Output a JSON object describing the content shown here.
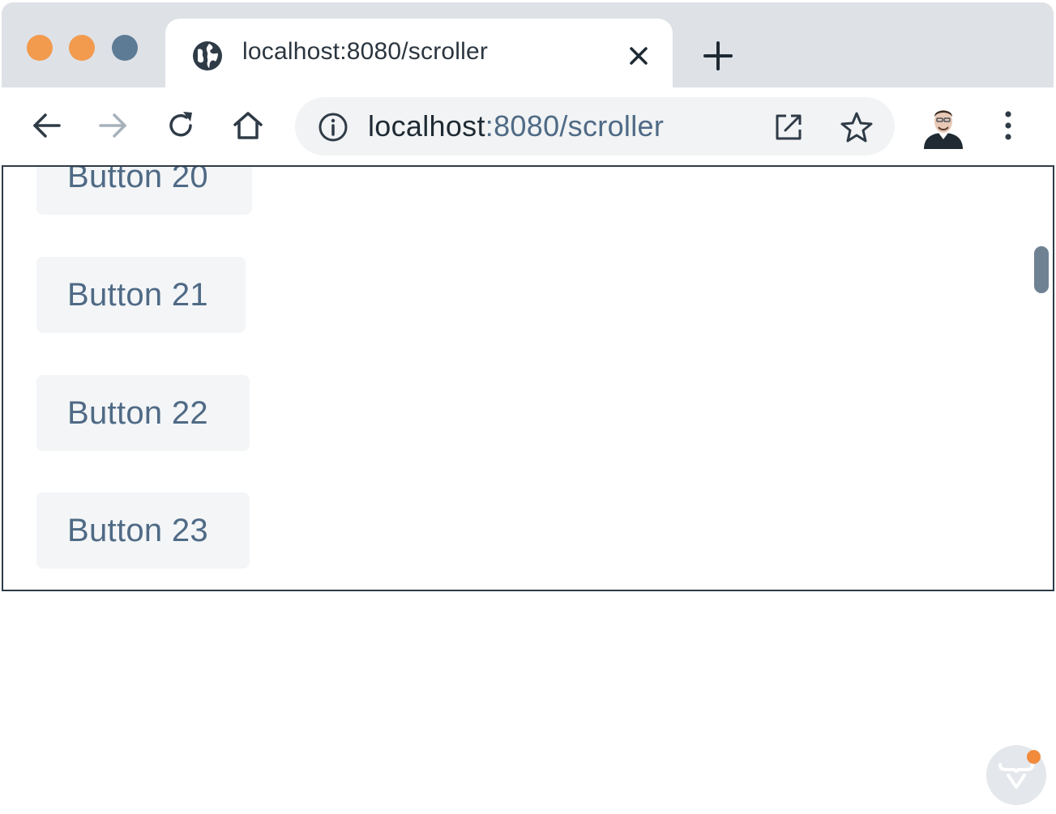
{
  "window": {
    "traffic_lights": [
      "close",
      "minimize",
      "maximize"
    ],
    "colors": {
      "close": "#f29a4e",
      "minimize": "#f29a4e",
      "maximize": "#5d7b95"
    }
  },
  "tab": {
    "title": "localhost:8080/scroller",
    "icon": "globe-icon",
    "close_icon": "close-icon"
  },
  "new_tab": {
    "icon": "plus-icon"
  },
  "toolbar": {
    "back_icon": "back-arrow-icon",
    "forward_icon": "forward-arrow-icon",
    "reload_icon": "reload-icon",
    "home_icon": "home-icon",
    "omnibox": {
      "info_icon": "info-icon",
      "host": "localhost",
      "path": ":8080/scroller",
      "open_icon": "open-in-new-window-icon",
      "bookmark_icon": "star-icon"
    },
    "profile_icon": "avatar",
    "menu_icon": "more-vertical-icon"
  },
  "scroller": {
    "buttons": [
      {
        "label": "Button 20"
      },
      {
        "label": "Button 21"
      },
      {
        "label": "Button 22"
      },
      {
        "label": "Button 23"
      }
    ],
    "scroll_position": 0.12
  },
  "dev_tools": {
    "icon": "vaadin-logo-icon",
    "notification_color": "#f28a3b"
  },
  "colors": {
    "accent_text": "#4f6a85",
    "button_bg": "#f3f5f7",
    "tab_strip_bg": "#dee1e6"
  }
}
